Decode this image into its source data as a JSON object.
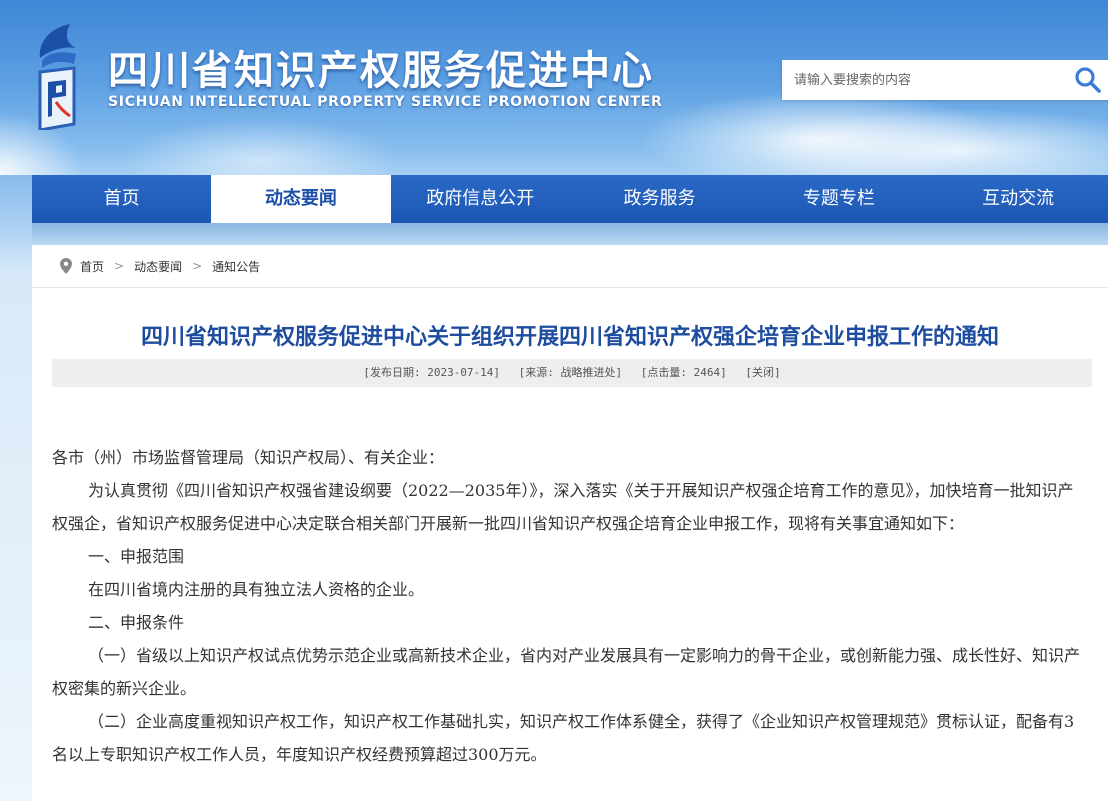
{
  "header": {
    "title": "四川省知识产权服务促进中心",
    "subtitle": "SICHUAN INTELLECTUAL PROPERTY SERVICE PROMOTION CENTER",
    "search_placeholder": "请输入要搜索的内容",
    "search_icon": "search-icon",
    "logo_icon": "logo-icon"
  },
  "nav": {
    "items": [
      {
        "label": "首页"
      },
      {
        "label": "动态要闻",
        "active": true
      },
      {
        "label": "政府信息公开"
      },
      {
        "label": "政务服务"
      },
      {
        "label": "专题专栏"
      },
      {
        "label": "互动交流"
      }
    ]
  },
  "breadcrumb": {
    "icon": "location-pin-icon",
    "items": [
      "首页",
      "动态要闻",
      "通知公告"
    ],
    "separator": ">"
  },
  "article": {
    "title": "四川省知识产权服务促进中心关于组织开展四川省知识产权强企培育企业申报工作的通知",
    "meta": {
      "date": "[发布日期: 2023-07-14]",
      "source": "[来源: 战略推进处]",
      "hits": "[点击量: 2464]",
      "close": "[关闭]"
    },
    "paragraphs": [
      "各市（州）市场监督管理局（知识产权局）、有关企业：",
      "为认真贯彻《四川省知识产权强省建设纲要（2022—2035年）》，深入落实《关于开展知识产权强企培育工作的意见》，加快培育一批知识产权强企，省知识产权服务促进中心决定联合相关部门开展新一批四川省知识产权强企培育企业申报工作，现将有关事宜通知如下：",
      "一、申报范围",
      "在四川省境内注册的具有独立法人资格的企业。",
      "二、申报条件",
      "（一）省级以上知识产权试点优势示范企业或高新技术企业，省内对产业发展具有一定影响力的骨干企业，或创新能力强、成长性好、知识产权密集的新兴企业。",
      "（二）企业高度重视知识产权工作，知识产权工作基础扎实，知识产权工作体系健全，获得了《企业知识产权管理规范》贯标认证，配备有3名以上专职知识产权工作人员，年度知识产权经费预算超过300万元。"
    ]
  },
  "colors": {
    "nav_bg": "#1d57b3",
    "title_blue": "#1e4c9e",
    "active_text": "#1d4fa8"
  }
}
